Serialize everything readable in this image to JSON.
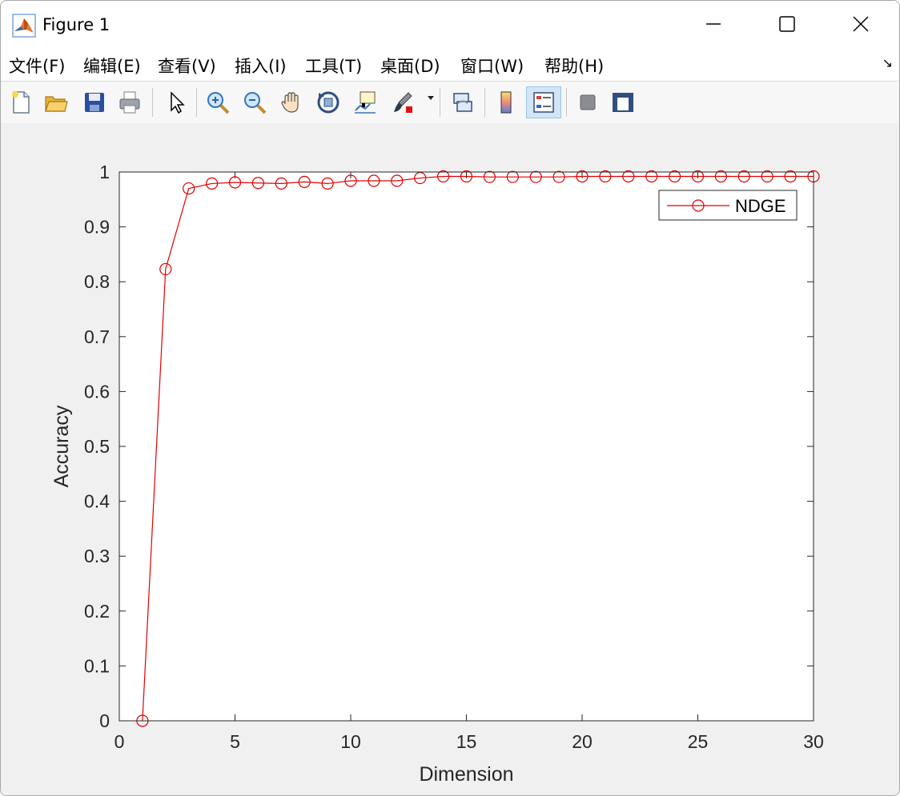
{
  "window": {
    "title": "Figure 1",
    "controls": {
      "minimize": "minimize",
      "maximize": "maximize",
      "close": "close"
    }
  },
  "menu": {
    "items": [
      "文件(F)",
      "编辑(E)",
      "查看(V)",
      "插入(I)",
      "工具(T)",
      "桌面(D)",
      "窗口(W)",
      "帮助(H)"
    ],
    "overflow_glyph": "↘"
  },
  "toolbar": {
    "buttons": [
      {
        "icon": "new-figure-icon"
      },
      {
        "icon": "open-folder-icon"
      },
      {
        "icon": "save-icon"
      },
      {
        "icon": "print-icon"
      },
      {
        "icon": "pointer-arrow-icon"
      },
      {
        "icon": "zoom-in-icon"
      },
      {
        "icon": "zoom-out-icon"
      },
      {
        "icon": "pan-hand-icon"
      },
      {
        "icon": "rotate-3d-icon"
      },
      {
        "icon": "data-cursor-icon"
      },
      {
        "icon": "brush-icon"
      },
      {
        "icon": "link-plot-icon"
      },
      {
        "icon": "colorbar-icon"
      },
      {
        "icon": "legend-icon"
      },
      {
        "icon": "hide-plot-tools-icon"
      },
      {
        "icon": "show-plot-tools-icon"
      }
    ],
    "colors": {
      "accent": "#1f6fd0",
      "active_bg": "#d3e6f7"
    }
  },
  "chart_data": {
    "type": "line",
    "xlabel": "Dimension",
    "ylabel": "Accuracy",
    "xlim": [
      0,
      30
    ],
    "ylim": [
      0,
      1
    ],
    "xticks": [
      0,
      5,
      10,
      15,
      20,
      25,
      30
    ],
    "yticks": [
      0,
      0.1,
      0.2,
      0.3,
      0.4,
      0.5,
      0.6,
      0.7,
      0.8,
      0.9,
      1
    ],
    "xtick_labels": [
      "0",
      "5",
      "10",
      "15",
      "20",
      "25",
      "30"
    ],
    "ytick_labels": [
      "0",
      "0.1",
      "0.2",
      "0.3",
      "0.4",
      "0.5",
      "0.6",
      "0.7",
      "0.8",
      "0.9",
      "1"
    ],
    "grid": false,
    "legend_position": "top-right",
    "series": [
      {
        "name": "NDGE",
        "color": "#e00000",
        "marker": "circle",
        "x": [
          1,
          2,
          3,
          4,
          5,
          6,
          7,
          8,
          9,
          10,
          11,
          12,
          13,
          14,
          15,
          16,
          17,
          18,
          19,
          20,
          21,
          22,
          23,
          24,
          25,
          26,
          27,
          28,
          29,
          30
        ],
        "y": [
          0.0,
          0.823,
          0.97,
          0.979,
          0.981,
          0.98,
          0.979,
          0.982,
          0.979,
          0.984,
          0.984,
          0.984,
          0.989,
          0.992,
          0.992,
          0.991,
          0.991,
          0.991,
          0.991,
          0.992,
          0.992,
          0.992,
          0.992,
          0.992,
          0.992,
          0.992,
          0.992,
          0.992,
          0.992,
          0.992
        ]
      }
    ]
  }
}
